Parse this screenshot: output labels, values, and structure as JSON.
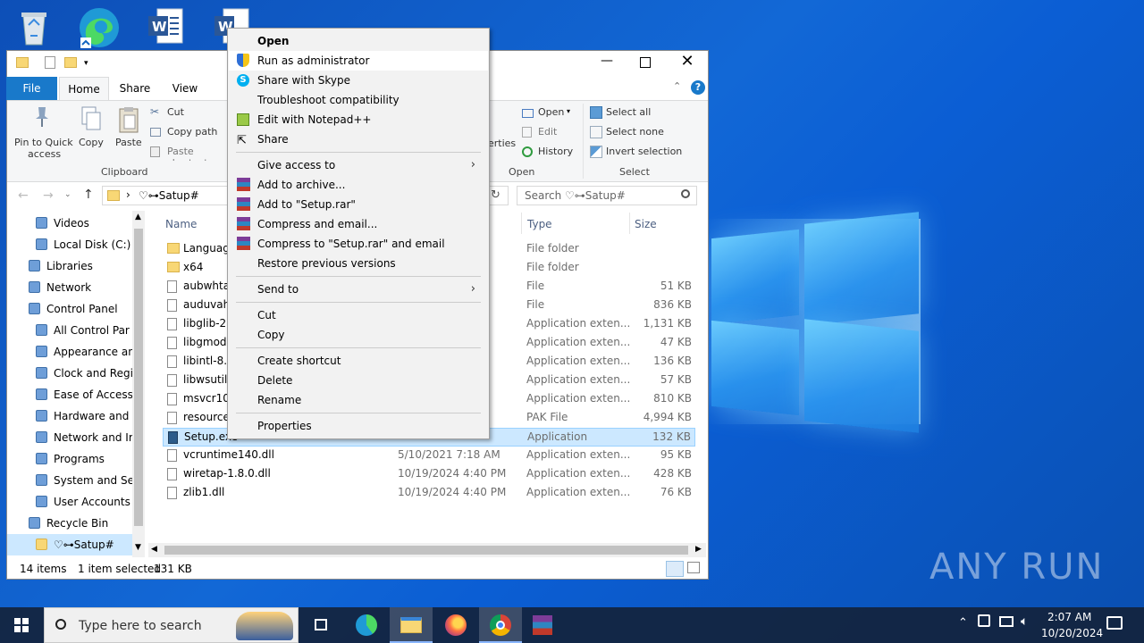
{
  "explorer": {
    "tabs": [
      "File",
      "Home",
      "Share",
      "View"
    ],
    "ribbon": {
      "pin_label_1": "Pin to Quick",
      "pin_label_2": "access",
      "copy": "Copy",
      "paste": "Paste",
      "cut": "Cut",
      "copy_path": "Copy path",
      "paste_shortcut": "Paste shortcut",
      "clipboard_group": "Clipboard",
      "properties_partial": "erties",
      "open": "Open",
      "edit": "Edit",
      "history": "History",
      "open_group": "Open",
      "select_all": "Select all",
      "select_none": "Select none",
      "invert_selection": "Invert selection",
      "select_group": "Select"
    },
    "address": {
      "separator": "›",
      "path": "♡⊶Satup#"
    },
    "search_placeholder": "Search ♡⊶Satup#",
    "nav": [
      {
        "label": "Videos",
        "icon": "videos-icon"
      },
      {
        "label": "Local Disk (C:)",
        "icon": "disk-icon"
      },
      {
        "label": "Libraries",
        "icon": "libraries-icon"
      },
      {
        "label": "Network",
        "icon": "network-icon"
      },
      {
        "label": "Control Panel",
        "icon": "control-panel-icon"
      },
      {
        "label": "All Control Par",
        "icon": "control-panel-icon"
      },
      {
        "label": "Appearance an",
        "icon": "appearance-icon"
      },
      {
        "label": "Clock and Regi",
        "icon": "clock-icon"
      },
      {
        "label": "Ease of Access",
        "icon": "ease-access-icon"
      },
      {
        "label": "Hardware and",
        "icon": "hardware-icon"
      },
      {
        "label": "Network and Ir",
        "icon": "network-icon"
      },
      {
        "label": "Programs",
        "icon": "programs-icon"
      },
      {
        "label": "System and Se",
        "icon": "system-icon"
      },
      {
        "label": "User Accounts",
        "icon": "user-icon"
      },
      {
        "label": "Recycle Bin",
        "icon": "recycle-bin-icon"
      },
      {
        "label": "♡⊶Satup#",
        "icon": "folder-icon"
      }
    ],
    "columns": {
      "name": "Name",
      "type": "Type",
      "size": "Size"
    },
    "files": [
      {
        "name": "Languag",
        "date": "",
        "type": "File folder",
        "size": ""
      },
      {
        "name": "x64",
        "date": "",
        "type": "File folder",
        "size": ""
      },
      {
        "name": "aubwhta",
        "date": "",
        "type": "File",
        "size": "51 KB"
      },
      {
        "name": "auduvah",
        "date": "",
        "type": "File",
        "size": "836 KB"
      },
      {
        "name": "libglib-2.",
        "date": "",
        "type": "Application exten...",
        "size": "1,131 KB"
      },
      {
        "name": "libgmod",
        "date": "",
        "type": "Application exten...",
        "size": "47 KB"
      },
      {
        "name": "libintl-8.",
        "date": "",
        "type": "Application exten...",
        "size": "136 KB"
      },
      {
        "name": "libwsutil.",
        "date": "",
        "type": "Application exten...",
        "size": "57 KB"
      },
      {
        "name": "msvcr100",
        "date": "",
        "type": "Application exten...",
        "size": "810 KB"
      },
      {
        "name": "resources",
        "date": "",
        "type": "PAK File",
        "size": "4,994 KB"
      },
      {
        "name": "Setup.exe",
        "date": "",
        "type": "Application",
        "size": "132 KB"
      },
      {
        "name": "vcruntime140.dll",
        "date": "5/10/2021 7:18 AM",
        "type": "Application exten...",
        "size": "95 KB"
      },
      {
        "name": "wiretap-1.8.0.dll",
        "date": "10/19/2024 4:40 PM",
        "type": "Application exten...",
        "size": "428 KB"
      },
      {
        "name": "zlib1.dll",
        "date": "10/19/2024 4:40 PM",
        "type": "Application exten...",
        "size": "76 KB"
      }
    ],
    "status": {
      "items": "14 items",
      "selected": "1 item selected",
      "size": "131 KB"
    }
  },
  "context_menu": {
    "open": "Open",
    "run_admin": "Run as administrator",
    "share_skype": "Share with Skype",
    "troubleshoot": "Troubleshoot compatibility",
    "notepad": "Edit with Notepad++",
    "share": "Share",
    "give_access": "Give access to",
    "add_archive": "Add to archive...",
    "add_rar": "Add to \"Setup.rar\"",
    "compress_email": "Compress and email...",
    "compress_rar_email": "Compress to \"Setup.rar\" and email",
    "restore": "Restore previous versions",
    "send_to": "Send to",
    "cut": "Cut",
    "copy": "Copy",
    "create_shortcut": "Create shortcut",
    "delete": "Delete",
    "rename": "Rename",
    "properties": "Properties"
  },
  "taskbar": {
    "search_placeholder": "Type here to search",
    "time": "2:07 AM",
    "date": "10/20/2024"
  },
  "watermark": "ANY RUN",
  "colors": {
    "accent": "#1979ca",
    "selection": "#cce8ff",
    "desktop": "#0d5bc8"
  }
}
